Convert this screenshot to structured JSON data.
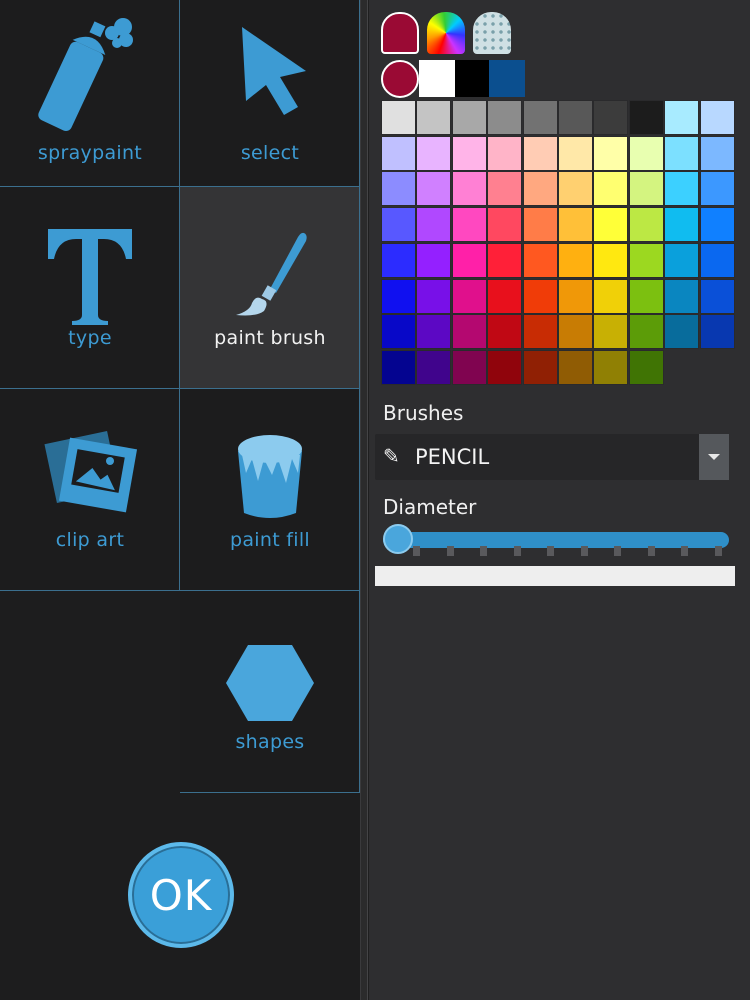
{
  "tools": [
    {
      "id": "spraypaint",
      "label": "spraypaint",
      "icon": "spray-can-icon",
      "selected": false
    },
    {
      "id": "select",
      "label": "select",
      "icon": "cursor-arrow-icon",
      "selected": false
    },
    {
      "id": "type",
      "label": "type",
      "icon": "text-t-icon",
      "selected": false
    },
    {
      "id": "paint-brush",
      "label": "paint brush",
      "icon": "paintbrush-icon",
      "selected": true
    },
    {
      "id": "clip-art",
      "label": "clip art",
      "icon": "photos-icon",
      "selected": false
    },
    {
      "id": "paint-fill",
      "label": "paint fill",
      "icon": "paint-bucket-icon",
      "selected": false
    },
    {
      "id": "shapes",
      "label": "shapes",
      "icon": "hexagon-icon",
      "selected": false
    }
  ],
  "ok_label": "OK",
  "colors": {
    "accent": "#3a9fd8",
    "current": "#9a0a34",
    "recent": [
      "#ffffff",
      "#000000",
      "#0b4f8f"
    ]
  },
  "palette_rows": [
    [
      "#e0e0e0",
      "#c4c4c4",
      "#a8a8a8",
      "#8c8c8c",
      "#727272",
      "#585858",
      "#3c3c3c",
      "#1c1c1c",
      "#a8ebff",
      "#b8d8ff"
    ],
    [
      "#c0c0ff",
      "#e8b4ff",
      "#ffb4e8",
      "#ffb4c8",
      "#ffccb4",
      "#ffe8a8",
      "#ffffa8",
      "#e8ffb0",
      "#7ce0ff",
      "#7cb8ff"
    ],
    [
      "#8c8cff",
      "#d080ff",
      "#ff80d4",
      "#ff8090",
      "#ffa880",
      "#ffd070",
      "#ffff70",
      "#d4f480",
      "#3cd0ff",
      "#3c98ff"
    ],
    [
      "#5858ff",
      "#b048ff",
      "#ff48c0",
      "#ff4860",
      "#ff7c48",
      "#ffc038",
      "#ffff38",
      "#bce844",
      "#10bcf0",
      "#1080ff"
    ],
    [
      "#2c2cff",
      "#9420ff",
      "#ff20a8",
      "#ff2038",
      "#ff5820",
      "#ffb010",
      "#ffe810",
      "#9cd820",
      "#0aa0dc",
      "#0a68f0"
    ],
    [
      "#1010f0",
      "#7810e8",
      "#e0108c",
      "#e8101c",
      "#f03c08",
      "#f09808",
      "#f0d008",
      "#7cc010",
      "#0a86c0",
      "#0a50d8"
    ],
    [
      "#0808c8",
      "#5c08c4",
      "#b40870",
      "#c00814",
      "#c82c04",
      "#c87c04",
      "#c8b004",
      "#5c9c08",
      "#086c9c",
      "#0838b0"
    ],
    [
      "#040490",
      "#40048c",
      "#800450",
      "#90040c",
      "#902004",
      "#905c04",
      "#908004",
      "#407404"
    ]
  ],
  "brushes": {
    "label": "Brushes",
    "icon": "pencil-icon",
    "pencil_glyph": "✎",
    "selected": "PENCIL"
  },
  "diameter": {
    "label": "Diameter",
    "value_fraction": 0.0,
    "tick_count": 10
  }
}
